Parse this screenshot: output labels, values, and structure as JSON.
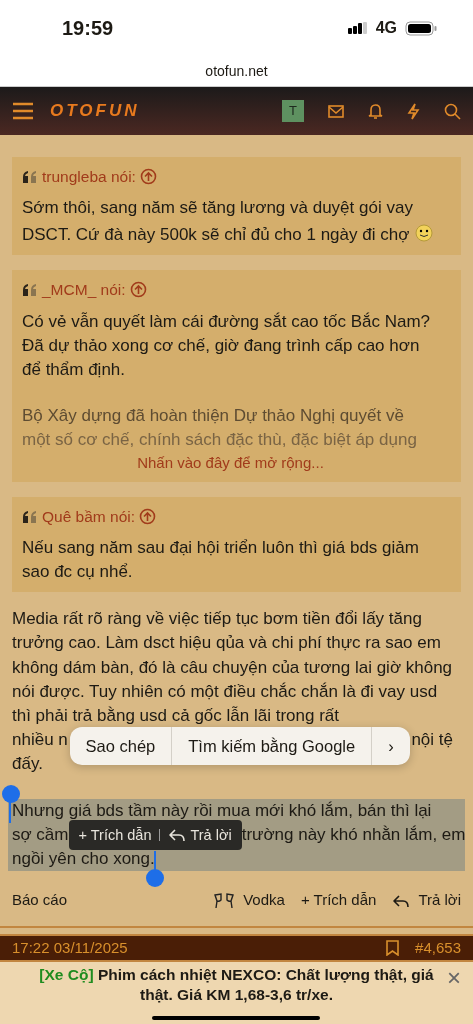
{
  "status_bar": {
    "time": "19:59",
    "network": "4G"
  },
  "address_bar": {
    "url": "otofun.net"
  },
  "header": {
    "logo": "OTOFUN",
    "avatar_letter": "T"
  },
  "quotes": [
    {
      "author": "trungleba nói:",
      "paragraphs": [
        "Sớm thôi, sang năm sẽ tăng lương và duyệt gói vay DSCT. Cứ đà này 500k sẽ chỉ đủ cho 1 ngày đi chợ"
      ],
      "emoji": true,
      "collapsed": false
    },
    {
      "author": "_MCM_ nói:",
      "paragraphs": [
        "Có vẻ vẫn quyết làm cái đường sắt cao tốc Bắc Nam? Đã dự thảo xong cơ chế, giờ đang trình cấp cao hơn để thẩm định.",
        "Bộ Xây dựng đã hoàn thiện Dự thảo Nghị quyết về",
        "một số cơ chế, chính sách đặc thù, đặc biệt áp dụng"
      ],
      "emoji": false,
      "collapsed": true,
      "expand_link": "Nhấn vào đây để mở rộng..."
    },
    {
      "author": "Quê bầm nói:",
      "paragraphs": [
        "Nếu sang năm sau đại hội triển luôn thì giá bds giảm sao đc cụ nhể."
      ],
      "emoji": false,
      "collapsed": false
    }
  ],
  "post": {
    "paragraph": "Media rất rõ ràng về việc tiếp tục bơm tiền đổi lấy tăng trưởng cao. Làm dsct hiệu qủa và chi phí thực ra sao em không dám bàn, đó là câu chuyện của tương lai giờ không nói được. Tuy nhiên có một điều chắc chắn là đi vay usd thì phải trả bằng usd cả gốc lẫn lãi trong rất",
    "covered_line_start": "nhiều n",
    "covered_line_end": "nội tệ",
    "paragraph_end": "đấy.",
    "selected_paragraph": {
      "lines": [
        [
          "Nhưng giá bds tầm này rồi mua mới khó lắm, bán thì lại"
        ],
        [
          "sợ cầm",
          "trường này khó nhằn lắm, em"
        ],
        [
          "ngồi yên cho xong."
        ]
      ],
      "selected": true
    },
    "context_menu": [
      "Sao chép",
      "Tìm kiếm bằng Google",
      "›"
    ],
    "selection_toolbar": [
      {
        "label": "+ Trích dẫn",
        "kind": "text"
      },
      {
        "label": "Trả lời",
        "kind": "reply"
      }
    ],
    "report": "Báo cáo",
    "actions": [
      {
        "label": "Vodka",
        "kind": "vodka"
      },
      {
        "label": "+ Trích dẫn",
        "kind": "text"
      },
      {
        "label": "Trả lời",
        "kind": "reply"
      }
    ]
  },
  "next_post": {
    "time": "17:22 03/11/2025",
    "number": "#4,653"
  },
  "ad_banner": {
    "tag": "[Xe Cộ]",
    "text": "Phim cách nhiệt NEXCO: Chất lượng thật, giá thật. Giá KM 1,68-3,6 tr/xe.",
    "close": "×"
  }
}
